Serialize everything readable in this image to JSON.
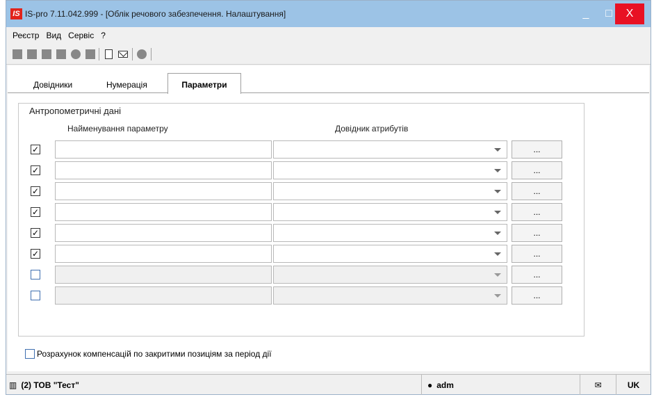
{
  "window": {
    "app_icon": "IS",
    "title": "IS-pro 7.11.042.999 - [Облік речового забезпечення. Налаштування]",
    "controls": {
      "minimize": "_",
      "maximize": "□",
      "close": "X"
    }
  },
  "menu": [
    "Реєстр",
    "Вид",
    "Сервіс",
    "?"
  ],
  "toolbar": {
    "icons": [
      "new-icon",
      "copy-icon",
      "edit-icon",
      "move-icon",
      "delete-icon",
      "print-icon",
      "document-icon",
      "envelope-icon",
      "info-icon"
    ]
  },
  "tabs": [
    {
      "label": "Довідники",
      "active": false
    },
    {
      "label": "Нумерація",
      "active": false
    },
    {
      "label": "Параметри",
      "active": true
    }
  ],
  "group": {
    "title": "Антропометричні дані",
    "col_name": "Найменування параметру",
    "col_dict": "Довідник атрибутів",
    "ellipsis_label": "...",
    "rows": [
      {
        "checked": true,
        "check_mark": "✓",
        "name": "",
        "dict": ""
      },
      {
        "checked": true,
        "check_mark": "✓",
        "name": "",
        "dict": ""
      },
      {
        "checked": true,
        "check_mark": "✓",
        "name": "",
        "dict": ""
      },
      {
        "checked": true,
        "check_mark": "✓",
        "name": "",
        "dict": ""
      },
      {
        "checked": true,
        "check_mark": "✓",
        "name": "",
        "dict": ""
      },
      {
        "checked": true,
        "check_mark": "✓",
        "name": "",
        "dict": ""
      },
      {
        "checked": false,
        "check_mark": "",
        "name": "",
        "dict": ""
      },
      {
        "checked": false,
        "check_mark": "",
        "name": "",
        "dict": ""
      }
    ]
  },
  "bottom_option": {
    "checked": false,
    "label": "Розрахунок компенсацій по закритими позиціям за період дії"
  },
  "status": {
    "org": "(2) ТОВ \"Тест\"",
    "user": "adm",
    "lang": "UK"
  }
}
